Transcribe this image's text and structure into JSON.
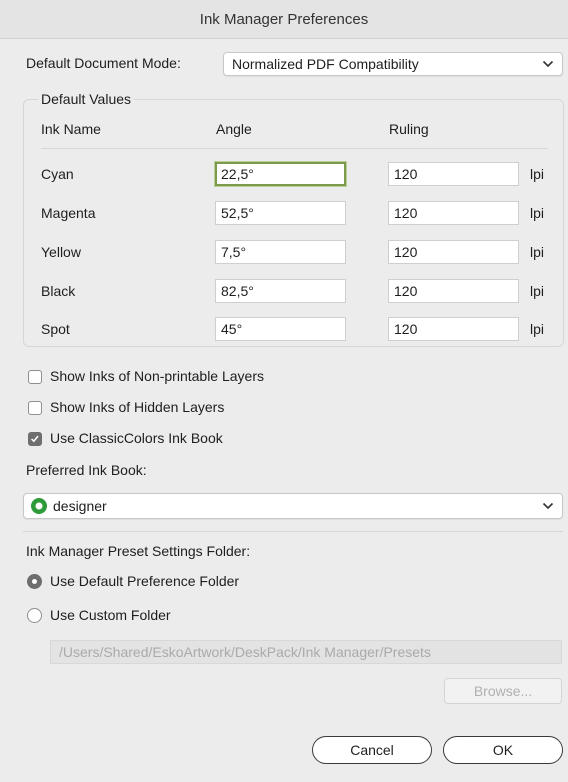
{
  "window": {
    "title": "Ink Manager Preferences"
  },
  "document_mode": {
    "label": "Default Document Mode:",
    "value": "Normalized PDF Compatibility"
  },
  "default_values": {
    "title": "Default Values",
    "headers": {
      "ink_name": "Ink Name",
      "angle": "Angle",
      "ruling": "Ruling"
    },
    "unit": "lpi",
    "inks": [
      {
        "name": "Cyan",
        "angle": "22,5°",
        "ruling": "120"
      },
      {
        "name": "Magenta",
        "angle": "52,5°",
        "ruling": "120"
      },
      {
        "name": "Yellow",
        "angle": "7,5°",
        "ruling": "120"
      },
      {
        "name": "Black",
        "angle": "82,5°",
        "ruling": "120"
      },
      {
        "name": "Spot",
        "angle": "45°",
        "ruling": "120"
      }
    ]
  },
  "options": {
    "show_non_printable": {
      "label": "Show Inks of Non-printable Layers",
      "checked": false
    },
    "show_hidden": {
      "label": "Show Inks of Hidden Layers",
      "checked": false
    },
    "use_classiccolors": {
      "label": "Use ClassicColors Ink Book",
      "checked": true
    }
  },
  "ink_book": {
    "label": "Preferred Ink Book:",
    "value": "designer",
    "icon": "designer-book-icon",
    "icon_color": "#2e9b3a"
  },
  "preset_folder": {
    "label": "Ink Manager Preset Settings Folder:",
    "default_option": "Use Default Preference Folder",
    "custom_option": "Use Custom Folder",
    "selected": "default",
    "path": "/Users/Shared/EskoArtwork/DeskPack/Ink Manager/Presets",
    "browse": "Browse..."
  },
  "buttons": {
    "cancel": "Cancel",
    "ok": "OK"
  }
}
